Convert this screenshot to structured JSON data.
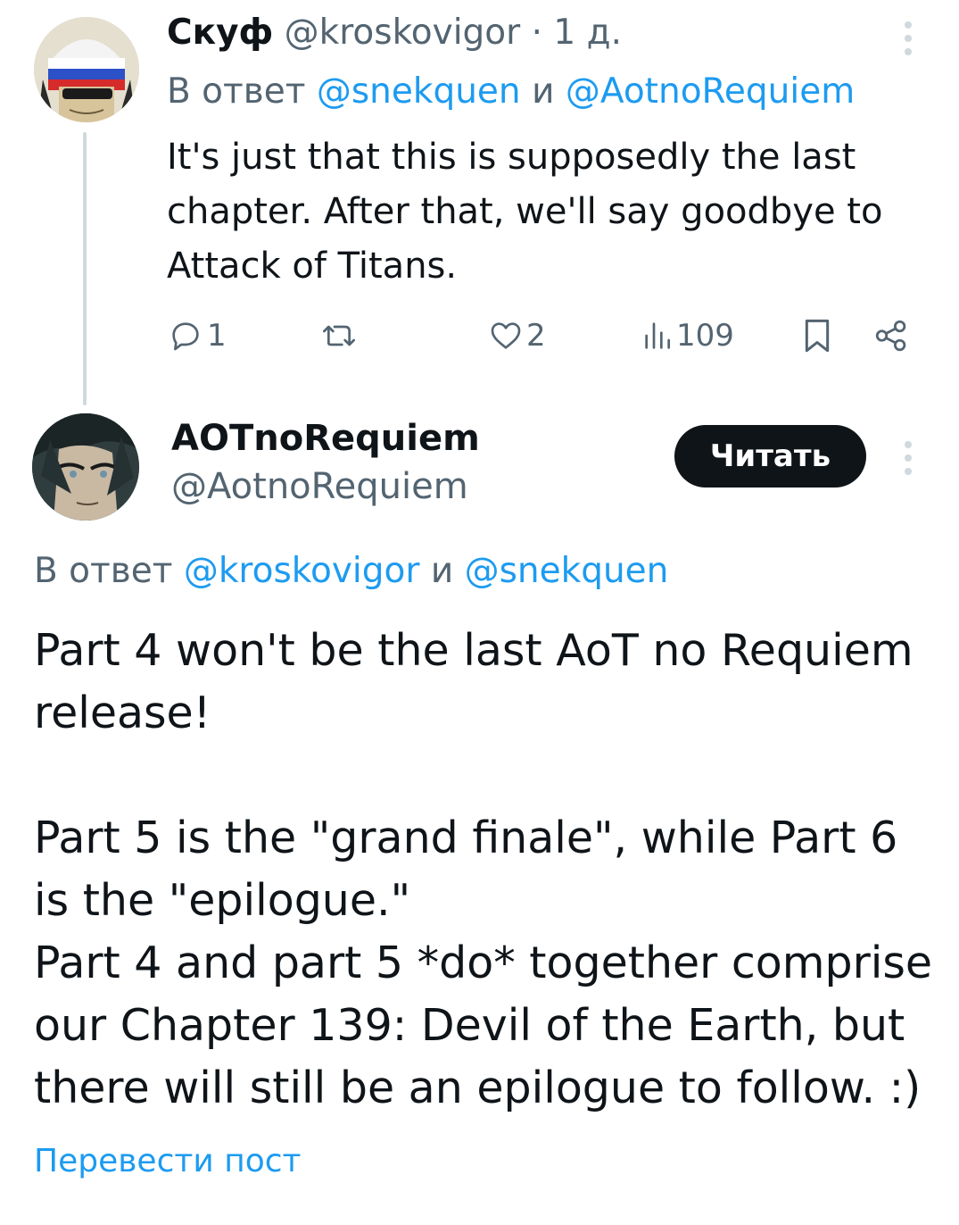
{
  "reply_tweet": {
    "author_name": "Скуф",
    "author_handle": "@kroskovigor",
    "separator": "·",
    "time": "1 д.",
    "reply_prefix": "В ответ",
    "reply_to_1": "@snekquen",
    "reply_and": "и",
    "reply_to_2": "@AotnoRequiem",
    "text": "It's just that this is supposedly the last chapter. After that, we'll say goodbye to Attack of Titans.",
    "actions": {
      "reply_icon": "comment-icon",
      "reply_count": "1",
      "retweet_icon": "retweet-icon",
      "like_icon": "heart-icon",
      "like_count": "2",
      "views_icon": "views-chart-icon",
      "view_count": "109",
      "bookmark_icon": "bookmark-icon",
      "share_icon": "share-icon"
    }
  },
  "main_tweet": {
    "author_name": "AOTnoRequiem",
    "author_handle": "@AotnoRequiem",
    "follow_label": "Читать",
    "reply_prefix": "В ответ",
    "reply_to_1": "@kroskovigor",
    "reply_and": "и",
    "reply_to_2": "@snekquen",
    "text": "Part 4 won't be the last AoT no Requiem release!\n\nPart 5 is the \"grand finale\", while Part 6 is the \"epilogue.\"\nPart 4 and part 5 *do* together comprise our Chapter 139: Devil of the Earth, but there will still be an epilogue to follow. :)",
    "translate_label": "Перевести пост"
  },
  "colors": {
    "link": "#1d9bf0",
    "muted": "#536471",
    "text": "#0f1419",
    "button_bg": "#0f1419"
  }
}
